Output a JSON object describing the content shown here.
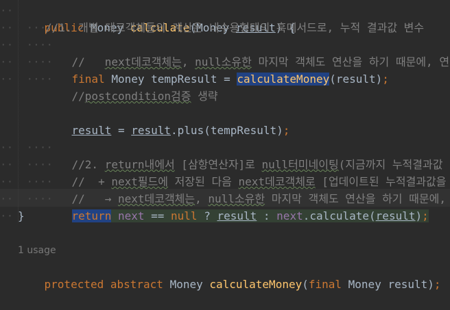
{
  "editor": {
    "l1": {
      "kw": "public ",
      "t1": "Money ",
      "fn": "calculate",
      "t2": "(Money ",
      "p": "result",
      "t3": ") {"
    },
    "l2": {
      "c": "//1. 개별 데코객체들의 계산은 내수용형태의 훅메서드로, 누적 결과값 변수"
    },
    "l3": {
      "c1": "//   ",
      "c2": "next데코객체는",
      "c3": ", ",
      "c4": "null소유한",
      "c5": " 마지막 객체도 연산을 하기 때문에, 연"
    },
    "l4": {
      "kw": "final ",
      "t1": "Money ",
      "t2": "tempResult",
      "t3": " = ",
      "fn": "calculateMoney",
      "t4": "(result)",
      "semi": ";"
    },
    "l5": {
      "c1": "//",
      "c2": "postcondition검증",
      "c3": " 생략"
    },
    "l6": {
      "v": "result",
      "t1": " = ",
      "v2": "result",
      "t2": ".plus(tempResult)",
      "semi": ";"
    },
    "l7": {
      "c1": "//2. ",
      "c2": "return내에서",
      "c3": " [삼항연산자]로 ",
      "c4": "null터미네이팅",
      "c5": "(지금까지 누적결과값"
    },
    "l8": {
      "c1": "//  + ",
      "c2": "next필드에",
      "c3": " 저장된 다음 ",
      "c4": "next데코객체로",
      "c5": " [업데이트된 누적결과값을"
    },
    "l9": {
      "c1": "//   → ",
      "c2": "next데코객체는",
      "c3": ", ",
      "c4": "null소유한",
      "c5": " 마지막 객체도 연산을 하기 때문에,"
    },
    "l10": {
      "kw": "return",
      "t1": " ",
      "f1": "next",
      "t2": " == ",
      "kw2": "null",
      "t3": " ? ",
      "v": "result",
      "t4": " : ",
      "f2": "next",
      "t5": ".calculate(",
      "v2": "result",
      "t6": ")",
      "semi": ";"
    },
    "l11": {
      "t": "}"
    },
    "usage": "1 usage",
    "l12": {
      "kw": "protected abstract ",
      "t1": "Money ",
      "fn": "calculateMoney",
      "t2": "(",
      "kw2": "final ",
      "t3": "Money result)",
      "semi": ";"
    }
  }
}
